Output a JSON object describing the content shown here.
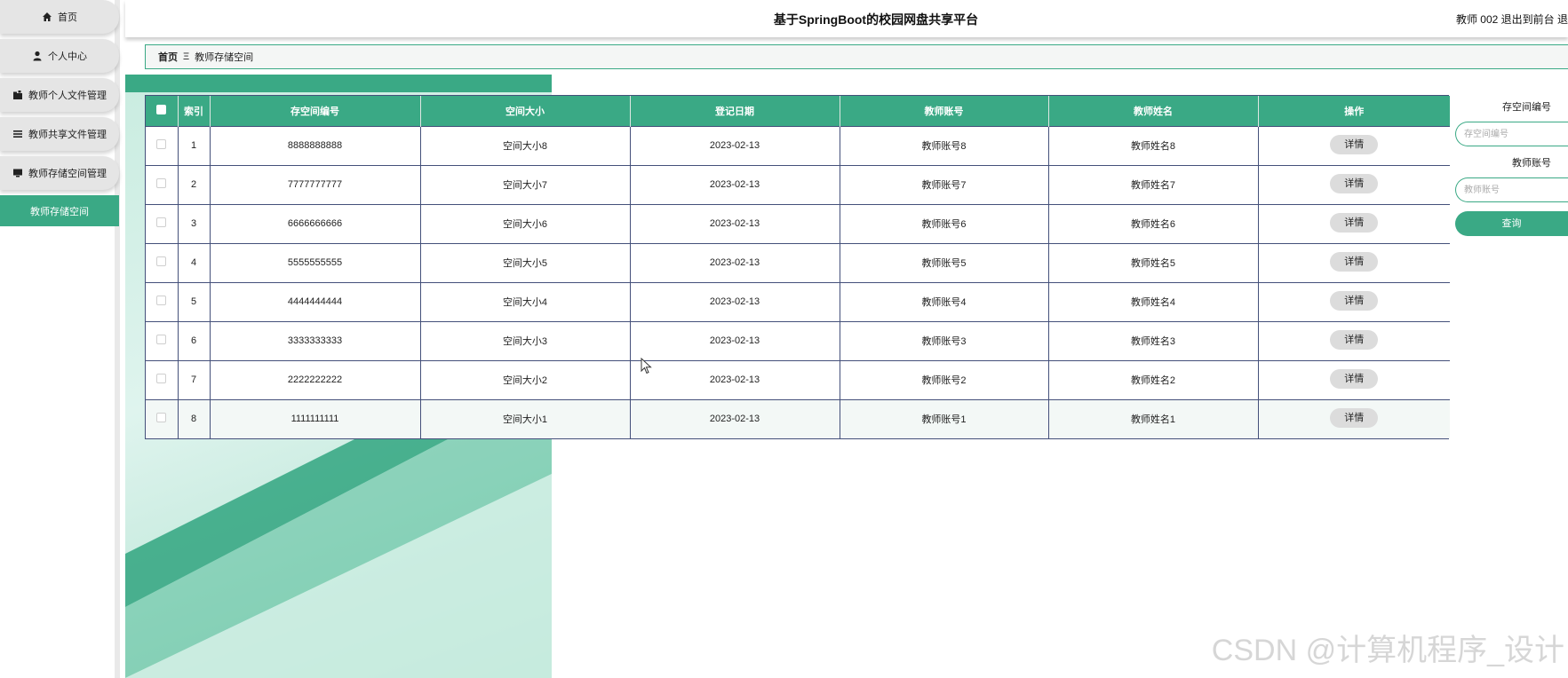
{
  "header": {
    "title": "基于SpringBoot的校园网盘共享平台",
    "user_text": "教师 002  退出到前台  退"
  },
  "sidebar": {
    "items": [
      {
        "label": "首页",
        "icon": "home-icon"
      },
      {
        "label": "个人中心",
        "icon": "user-icon"
      },
      {
        "label": "教师个人文件管理",
        "icon": "folder-icon"
      },
      {
        "label": "教师共享文件管理",
        "icon": "list-icon"
      },
      {
        "label": "教师存储空间管理",
        "icon": "monitor-icon"
      },
      {
        "label": "教师存储空间",
        "icon": ""
      }
    ]
  },
  "breadcrumb": {
    "home": "首页",
    "separator": "Ξ",
    "current": "教师存储空间"
  },
  "table": {
    "headers": [
      "",
      "索引",
      "存空间编号",
      "空间大小",
      "登记日期",
      "教师账号",
      "教师姓名",
      "操作"
    ],
    "rows": [
      {
        "index": "1",
        "code": "8888888888",
        "size": "空间大小8",
        "date": "2023-02-13",
        "account": "教师账号8",
        "name": "教师姓名8",
        "action": "详情"
      },
      {
        "index": "2",
        "code": "7777777777",
        "size": "空间大小7",
        "date": "2023-02-13",
        "account": "教师账号7",
        "name": "教师姓名7",
        "action": "详情"
      },
      {
        "index": "3",
        "code": "6666666666",
        "size": "空间大小6",
        "date": "2023-02-13",
        "account": "教师账号6",
        "name": "教师姓名6",
        "action": "详情"
      },
      {
        "index": "4",
        "code": "5555555555",
        "size": "空间大小5",
        "date": "2023-02-13",
        "account": "教师账号5",
        "name": "教师姓名5",
        "action": "详情"
      },
      {
        "index": "5",
        "code": "4444444444",
        "size": "空间大小4",
        "date": "2023-02-13",
        "account": "教师账号4",
        "name": "教师姓名4",
        "action": "详情"
      },
      {
        "index": "6",
        "code": "3333333333",
        "size": "空间大小3",
        "date": "2023-02-13",
        "account": "教师账号3",
        "name": "教师姓名3",
        "action": "详情"
      },
      {
        "index": "7",
        "code": "2222222222",
        "size": "空间大小2",
        "date": "2023-02-13",
        "account": "教师账号2",
        "name": "教师姓名2",
        "action": "详情"
      },
      {
        "index": "8",
        "code": "1111111111",
        "size": "空间大小1",
        "date": "2023-02-13",
        "account": "教师账号1",
        "name": "教师姓名1",
        "action": "详情"
      }
    ]
  },
  "search": {
    "code_label": "存空间编号",
    "code_placeholder": "存空间编号",
    "account_label": "教师账号",
    "account_placeholder": "教师账号",
    "button_label": "查询"
  },
  "watermark": "CSDN @计算机程序_设计",
  "colors": {
    "accent": "#3aa985",
    "table_border": "#44507a",
    "button_grey": "#dcdcdc"
  }
}
